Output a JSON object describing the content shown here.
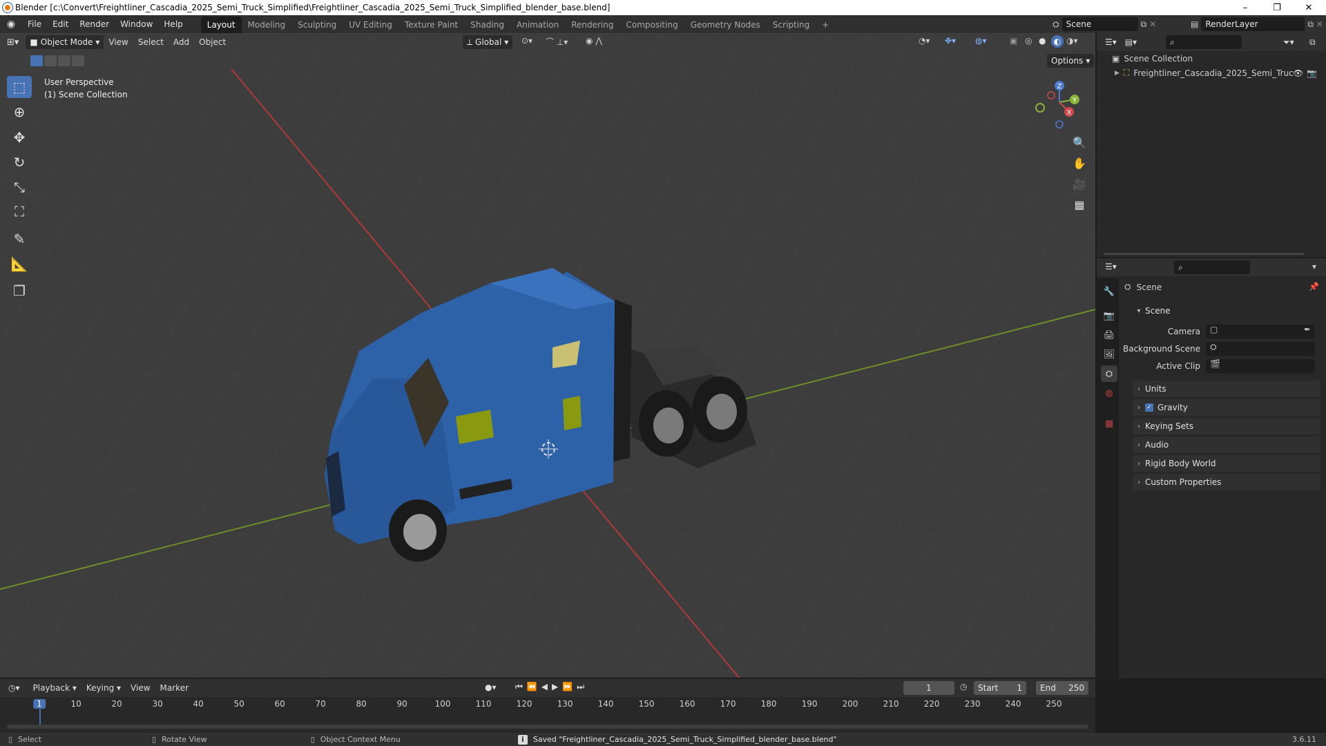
{
  "window": {
    "title": "Blender [c:\\Convert\\Freightliner_Cascadia_2025_Semi_Truck_Simplified\\Freightliner_Cascadia_2025_Semi_Truck_Simplified_blender_base.blend]",
    "minimize": "–",
    "maximize": "❐",
    "close": "✕"
  },
  "menu": [
    "File",
    "Edit",
    "Render",
    "Window",
    "Help"
  ],
  "workspaces": [
    "Layout",
    "Modeling",
    "Sculpting",
    "UV Editing",
    "Texture Paint",
    "Shading",
    "Animation",
    "Rendering",
    "Compositing",
    "Geometry Nodes",
    "Scripting"
  ],
  "active_workspace": "Layout",
  "add_workspace": "+",
  "scene_selector": "Scene",
  "view_layer_selector": "RenderLayer",
  "viewport": {
    "mode": "Object Mode",
    "menus": [
      "View",
      "Select",
      "Add",
      "Object"
    ],
    "orientation": "Global",
    "options": "Options",
    "overlay_title": "User Perspective",
    "overlay_subtitle": "(1) Scene Collection",
    "gizmo": {
      "z": "Z",
      "y": "Y",
      "x": "X"
    }
  },
  "outliner": {
    "root": "Scene Collection",
    "items": [
      {
        "label": "Freightliner_Cascadia_2025_Semi_Truc"
      }
    ]
  },
  "properties": {
    "header": "Scene",
    "panel": "Scene",
    "fields": [
      {
        "label": "Camera"
      },
      {
        "label": "Background Scene"
      },
      {
        "label": "Active Clip"
      }
    ],
    "sections": [
      "Units",
      "Gravity",
      "Keying Sets",
      "Audio",
      "Rigid Body World",
      "Custom Properties"
    ],
    "gravity_checked": true
  },
  "timeline": {
    "menus": [
      "Playback",
      "Keying",
      "View",
      "Marker"
    ],
    "current_frame": "1",
    "start_label": "Start",
    "start": "1",
    "end_label": "End",
    "end": "250",
    "ticks": [
      "1",
      "10",
      "20",
      "30",
      "40",
      "50",
      "60",
      "70",
      "80",
      "90",
      "100",
      "110",
      "120",
      "130",
      "140",
      "150",
      "160",
      "170",
      "180",
      "190",
      "200",
      "210",
      "220",
      "230",
      "240",
      "250"
    ]
  },
  "statusbar": {
    "select": "Select",
    "rotate": "Rotate View",
    "context": "Object Context Menu",
    "message": "Saved \"Freightliner_Cascadia_2025_Semi_Truck_Simplified_blender_base.blend\"",
    "version": "3.6.11"
  },
  "colors": {
    "accent": "#4772b3",
    "truck_body": "#2d62a8",
    "x_axis": "#c03a3a",
    "y_axis": "#7aa020"
  }
}
